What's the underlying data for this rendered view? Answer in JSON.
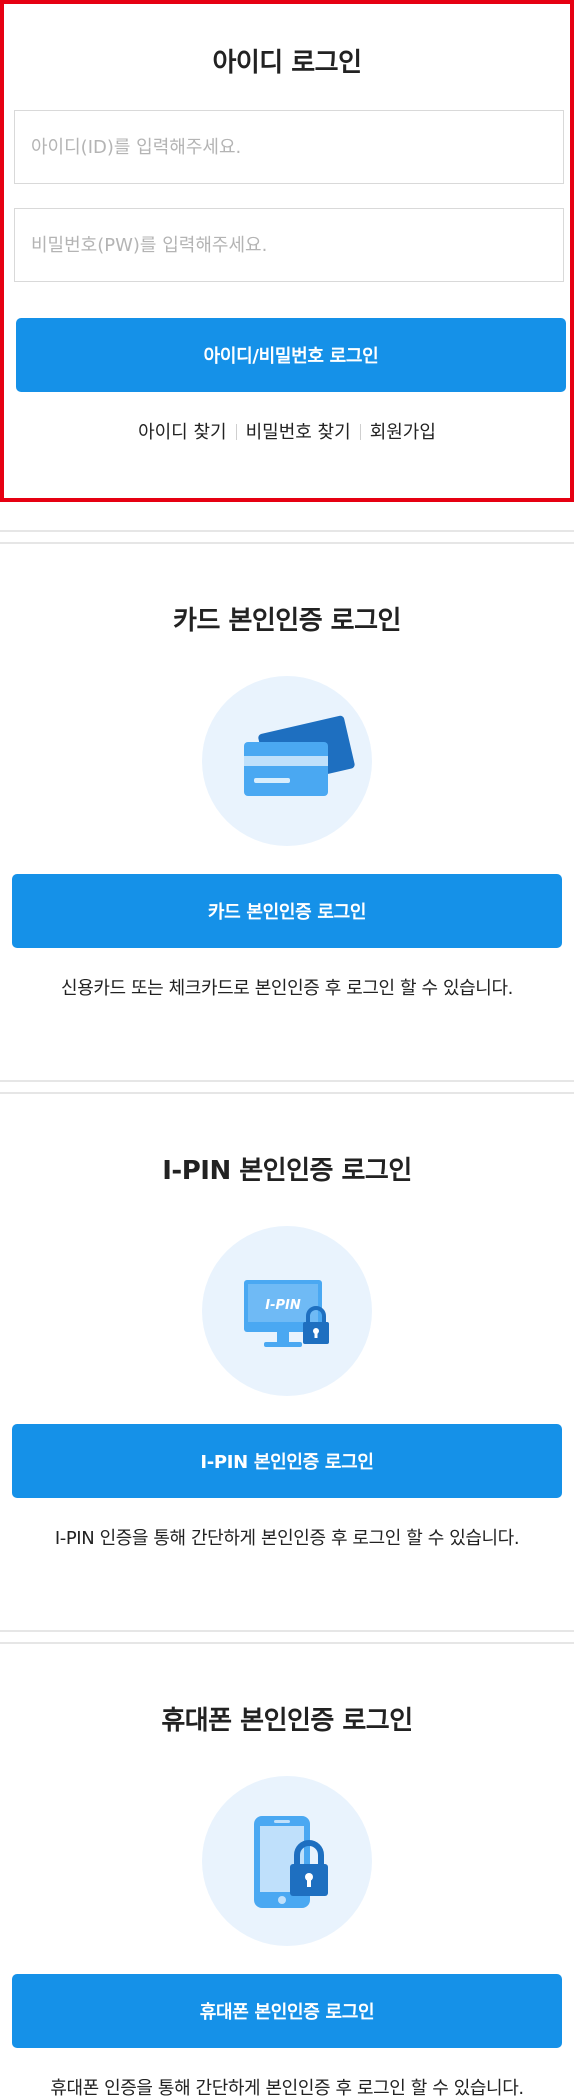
{
  "id_login": {
    "title": "아이디 로그인",
    "id_placeholder": "아이디(ID)를 입력해주세요.",
    "pw_placeholder": "비밀번호(PW)를 입력해주세요.",
    "login_button": "아이디/비밀번호 로그인",
    "links": {
      "find_id": "아이디 찾기",
      "find_pw": "비밀번호 찾기",
      "signup": "회원가입"
    }
  },
  "card_login": {
    "title": "카드 본인인증 로그인",
    "button": "카드 본인인증 로그인",
    "description": "신용카드 또는 체크카드로 본인인증 후 로그인 할 수 있습니다.",
    "icon": "credit-card-icon"
  },
  "ipin_login": {
    "title": "I-PIN 본인인증 로그인",
    "button": "I-PIN 본인인증 로그인",
    "description": "I-PIN 인증을 통해 간단하게 본인인증 후 로그인 할 수 있습니다.",
    "icon": "ipin-monitor-lock-icon",
    "icon_text": "I-PIN"
  },
  "phone_login": {
    "title": "휴대폰 본인인증 로그인",
    "button": "휴대폰 본인인증 로그인",
    "description": "휴대폰 인증을 통해 간단하게 본인인증 후 로그인 할 수 있습니다.",
    "icon": "phone-lock-icon"
  },
  "colors": {
    "accent": "#1591e8",
    "highlight_border": "#e60012",
    "icon_bg": "#e9f3fd",
    "icon_main": "#3fa2f0",
    "icon_dark": "#1e6fc0"
  }
}
